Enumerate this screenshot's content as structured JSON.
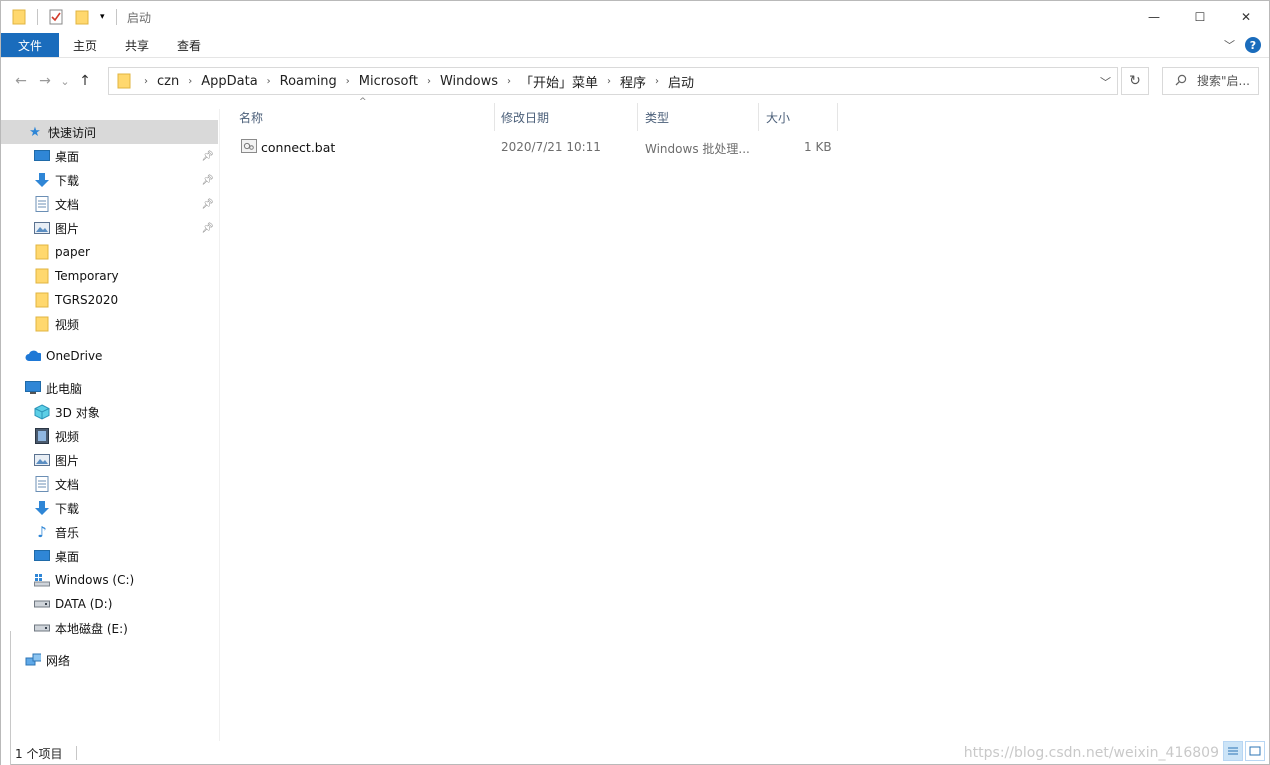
{
  "titlebar": {
    "title": "启动",
    "icons": [
      "folder-icon",
      "properties-icon",
      "new-folder-icon",
      "customize-qat-icon"
    ],
    "controls": {
      "minimize": "—",
      "maximize": "☐",
      "close": "✕"
    }
  },
  "ribbon": {
    "tabs": [
      "文件",
      "主页",
      "共享",
      "查看"
    ],
    "expand_icon": "﹀",
    "help": "?"
  },
  "nav": {
    "back": "←",
    "forward": "→",
    "recent": "⌄",
    "up": "↑",
    "breadcrumb": [
      "czn",
      "AppData",
      "Roaming",
      "Microsoft",
      "Windows",
      "「开始」菜单",
      "程序",
      "启动"
    ],
    "refresh": "↻",
    "search_placeholder": "搜索\"启..."
  },
  "sidebar": {
    "quick_access": "快速访问",
    "quick_items": [
      {
        "label": "桌面",
        "icon": "desktop-icon",
        "pinned": true
      },
      {
        "label": "下载",
        "icon": "download-icon",
        "pinned": true
      },
      {
        "label": "文档",
        "icon": "document-icon",
        "pinned": true
      },
      {
        "label": "图片",
        "icon": "pictures-icon",
        "pinned": true
      },
      {
        "label": "paper",
        "icon": "folder-icon",
        "pinned": false
      },
      {
        "label": "Temporary",
        "icon": "folder-icon",
        "pinned": false
      },
      {
        "label": "TGRS2020",
        "icon": "folder-icon",
        "pinned": false
      },
      {
        "label": "视频",
        "icon": "folder-icon",
        "pinned": false
      }
    ],
    "onedrive": "OneDrive",
    "this_pc": "此电脑",
    "pc_items": [
      {
        "label": "3D 对象",
        "icon": "3d-objects-icon"
      },
      {
        "label": "视频",
        "icon": "videos-icon"
      },
      {
        "label": "图片",
        "icon": "pictures-icon"
      },
      {
        "label": "文档",
        "icon": "document-icon"
      },
      {
        "label": "下载",
        "icon": "download-icon"
      },
      {
        "label": "音乐",
        "icon": "music-icon"
      },
      {
        "label": "桌面",
        "icon": "desktop-icon"
      },
      {
        "label": "Windows (C:)",
        "icon": "system-drive-icon"
      },
      {
        "label": "DATA (D:)",
        "icon": "drive-icon"
      },
      {
        "label": "本地磁盘 (E:)",
        "icon": "drive-icon"
      }
    ],
    "network": "网络"
  },
  "columns": {
    "name": "名称",
    "modified": "修改日期",
    "type": "类型",
    "size": "大小",
    "sort_indicator": "^"
  },
  "files": [
    {
      "name": "connect.bat",
      "modified": "2020/7/21 10:11",
      "type": "Windows 批处理...",
      "size": "1 KB",
      "icon": "batch-file-icon"
    }
  ],
  "status": {
    "count": "1 个项目"
  },
  "watermark": "https://blog.csdn.net/weixin_416809"
}
